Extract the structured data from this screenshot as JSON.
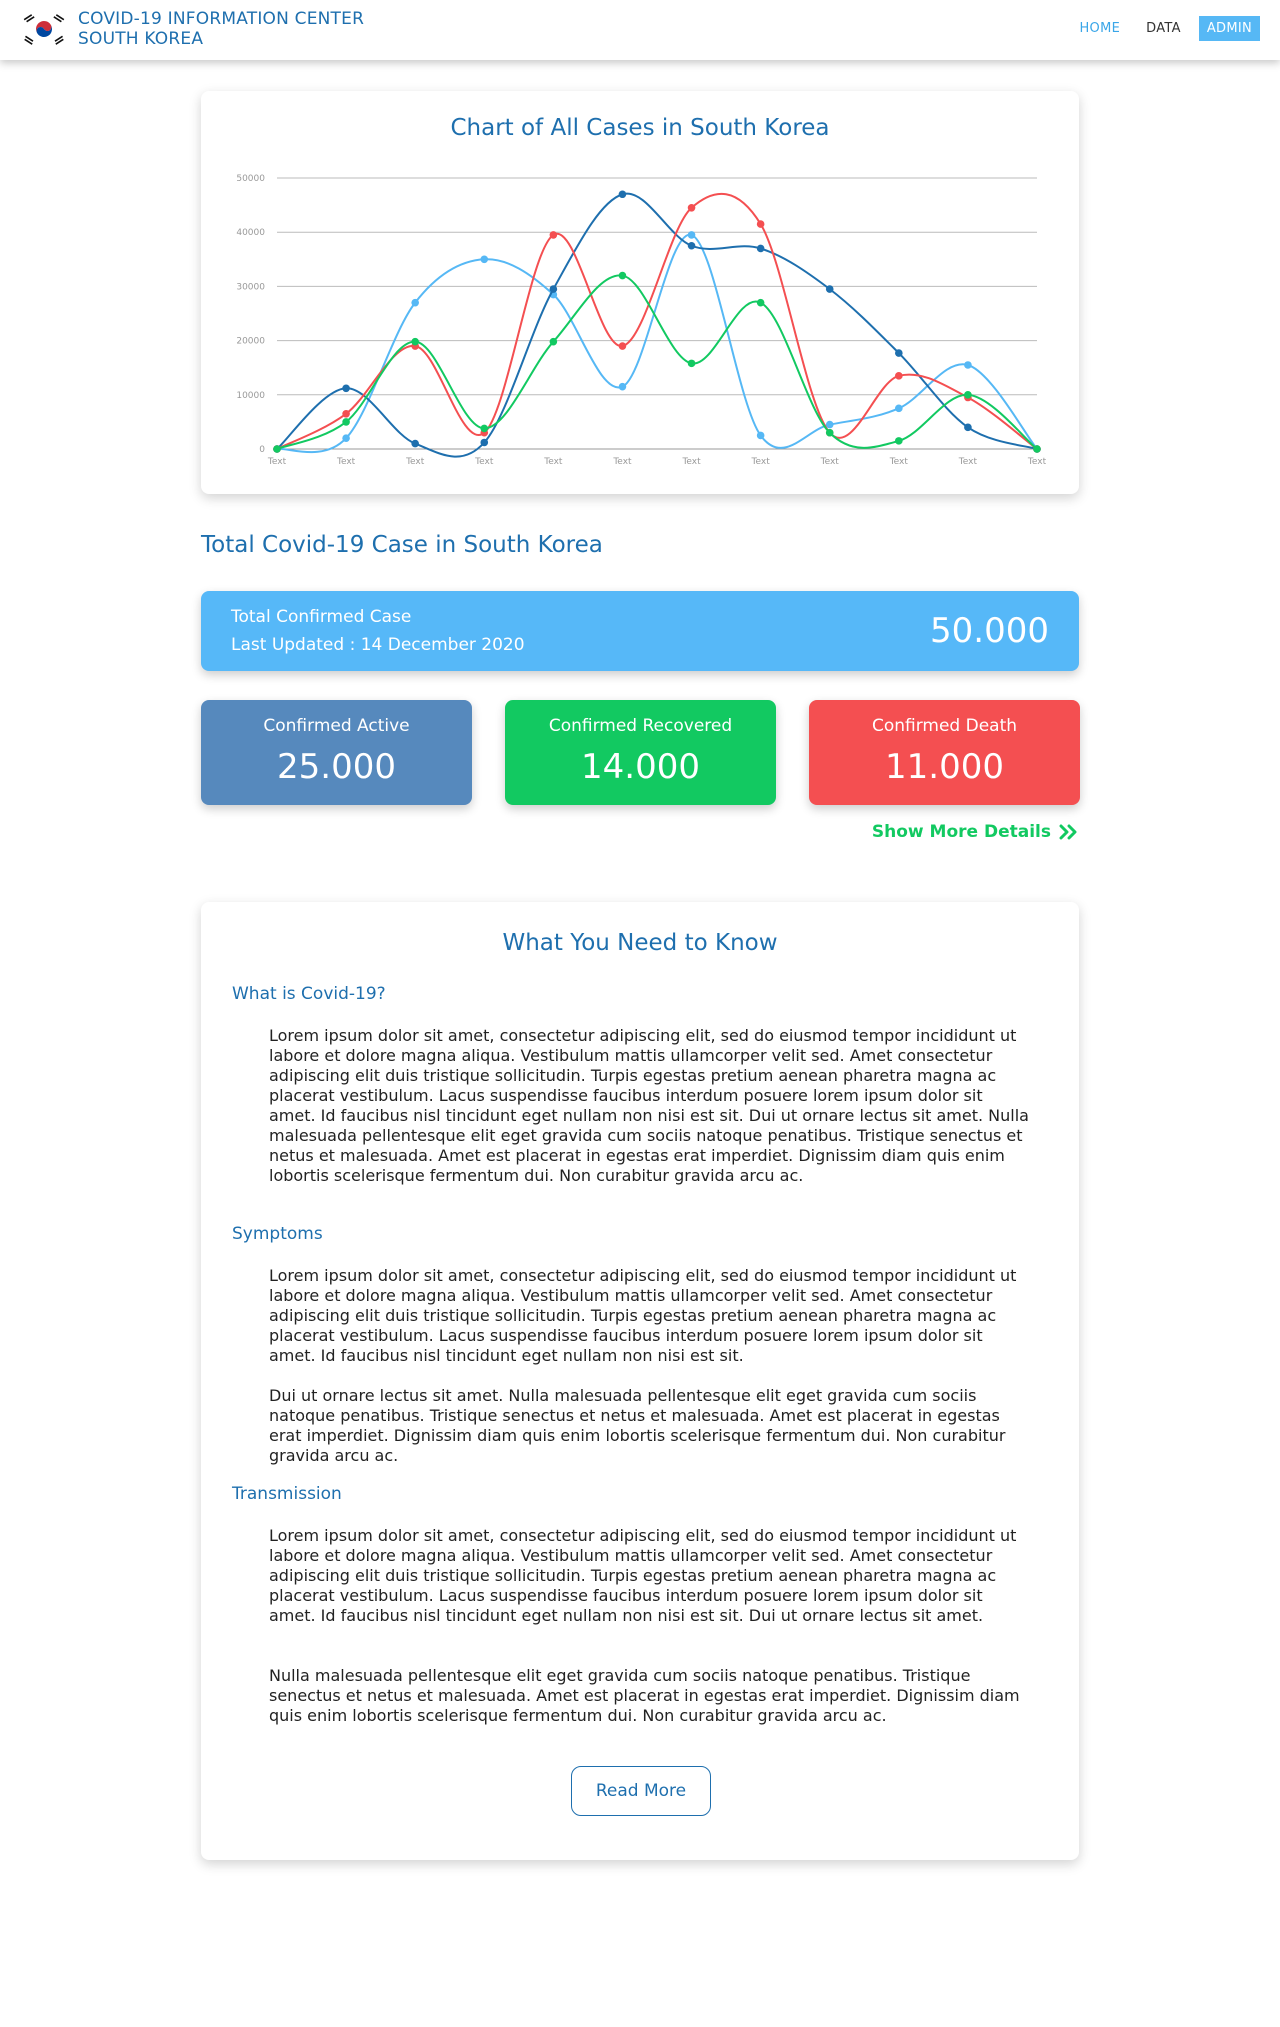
{
  "header": {
    "title_line1": "COVID-19 INFORMATION CENTER",
    "title_line2": "SOUTH KOREA",
    "nav": {
      "home": "HOME",
      "data": "DATA",
      "admin": "ADMIN"
    }
  },
  "chart_data": {
    "type": "line",
    "title": "Chart of All Cases in South Korea",
    "categories": [
      "Text",
      "Text",
      "Text",
      "Text",
      "Text",
      "Text",
      "Text",
      "Text",
      "Text",
      "Text",
      "Text",
      "Text"
    ],
    "ylim": [
      0,
      50000
    ],
    "yticks": [
      0,
      10000,
      20000,
      30000,
      40000,
      50000
    ],
    "grid": true,
    "series": [
      {
        "color": "#56b8f5",
        "values": [
          0,
          2000,
          27000,
          35000,
          28500,
          11500,
          39500,
          2500,
          4500,
          7500,
          15500,
          0
        ]
      },
      {
        "color": "#1e6fae",
        "values": [
          0,
          11200,
          1000,
          1200,
          29500,
          47000,
          37500,
          37000,
          29500,
          17700,
          4000,
          0
        ]
      },
      {
        "color": "#f44f51",
        "values": [
          0,
          6500,
          19000,
          3000,
          39500,
          19000,
          44500,
          41500,
          3000,
          13500,
          9500,
          0
        ]
      },
      {
        "color": "#12c961",
        "values": [
          0,
          5000,
          19800,
          3800,
          19800,
          32000,
          15800,
          27000,
          3000,
          1500,
          10000,
          0
        ]
      }
    ]
  },
  "summary": {
    "section_title": "Total Covid-19 Case in South Korea",
    "total_label": "Total Confirmed Case",
    "last_updated": "Last Updated : 14 December 2020",
    "total_value": "50.000",
    "active_label": "Confirmed Active",
    "active_value": "25.000",
    "recovered_label": "Confirmed Recovered",
    "recovered_value": "14.000",
    "death_label": "Confirmed Death",
    "death_value": "11.000",
    "more_link": "Show More Details"
  },
  "info": {
    "title": "What You Need to Know",
    "sections": [
      {
        "heading": "What is Covid-19?",
        "paragraphs": [
          "Lorem ipsum dolor sit amet, consectetur adipiscing elit, sed do eiusmod tempor incididunt ut labore et dolore magna aliqua. Vestibulum mattis ullamcorper velit sed. Amet consectetur adipiscing elit duis tristique sollicitudin. Turpis egestas pretium aenean pharetra magna ac placerat vestibulum. Lacus suspendisse faucibus interdum posuere lorem ipsum dolor sit amet. Id faucibus nisl tincidunt eget nullam non nisi est sit. Dui ut ornare lectus sit amet. Nulla malesuada pellentesque elit eget gravida cum sociis natoque penatibus. Tristique senectus et netus et malesuada. Amet est placerat in egestas erat imperdiet. Dignissim diam quis enim lobortis scelerisque fermentum dui. Non curabitur gravida arcu ac."
        ]
      },
      {
        "heading": "Symptoms",
        "paragraphs": [
          "Lorem ipsum dolor sit amet, consectetur adipiscing elit, sed do eiusmod tempor incididunt ut labore et dolore magna aliqua. Vestibulum mattis ullamcorper velit sed. Amet consectetur adipiscing elit duis tristique sollicitudin. Turpis egestas pretium aenean pharetra magna ac placerat vestibulum. Lacus suspendisse faucibus interdum posuere lorem ipsum dolor sit amet. Id faucibus nisl tincidunt eget nullam non nisi est sit.",
          "Dui ut ornare lectus sit amet. Nulla malesuada pellentesque elit eget gravida cum sociis natoque penatibus. Tristique senectus et netus et malesuada. Amet est placerat in egestas erat imperdiet. Dignissim diam quis enim lobortis scelerisque fermentum dui. Non curabitur gravida arcu ac."
        ]
      },
      {
        "heading": "Transmission",
        "paragraphs": [
          "Lorem ipsum dolor sit amet, consectetur adipiscing elit, sed do eiusmod tempor incididunt ut labore et dolore magna aliqua. Vestibulum mattis ullamcorper velit sed. Amet consectetur adipiscing elit duis tristique sollicitudin. Turpis egestas pretium aenean pharetra magna ac placerat vestibulum. Lacus suspendisse faucibus interdum posuere lorem ipsum dolor sit amet. Id faucibus nisl tincidunt eget nullam non nisi est sit. Dui ut ornare lectus sit amet.",
          "Nulla malesuada pellentesque elit eget gravida cum sociis natoque penatibus. Tristique senectus et netus et malesuada. Amet est placerat in egestas erat imperdiet. Dignissim diam quis enim lobortis scelerisque fermentum dui. Non curabitur gravida arcu ac."
        ]
      }
    ],
    "read_more": "Read More"
  }
}
